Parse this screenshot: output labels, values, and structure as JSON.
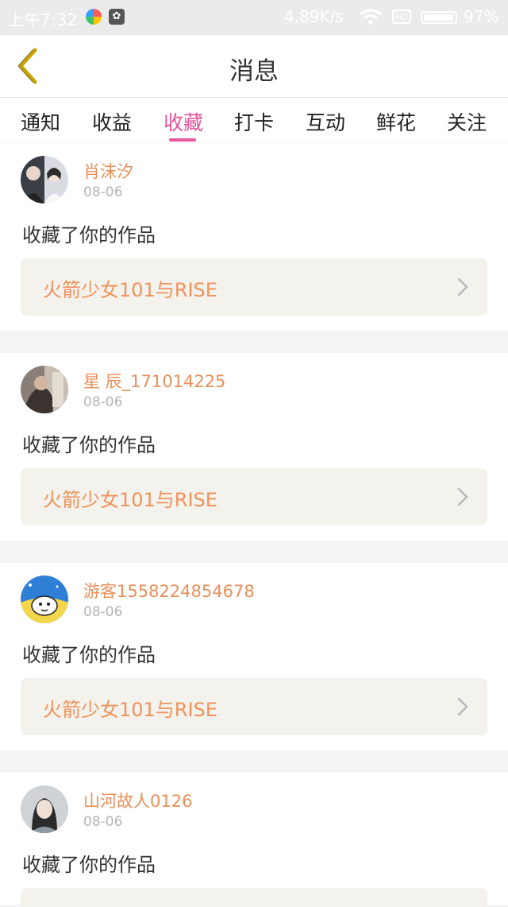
{
  "status_bar": {
    "time": "上午7:32",
    "network_speed": "4.89K/s",
    "battery_percent": "97%",
    "battery_level": 0.97,
    "icons": [
      "colorful-app-icon",
      "app-icon",
      "wifi-icon",
      "sim-icon",
      "battery-icon"
    ]
  },
  "header": {
    "title": "消息",
    "back_icon": "chevron-left-icon",
    "accent_color": "#c9a400"
  },
  "tabs": {
    "items": [
      {
        "label": "通知"
      },
      {
        "label": "收益"
      },
      {
        "label": "收藏"
      },
      {
        "label": "打卡"
      },
      {
        "label": "互动"
      },
      {
        "label": "鲜花"
      },
      {
        "label": "关注"
      }
    ],
    "active_index": 2,
    "active_color": "#e8559c"
  },
  "messages": [
    {
      "username": "肖沫汐",
      "date": "08-06",
      "action": "收藏了你的作品",
      "work_title": "火箭少女101与RISE"
    },
    {
      "username": "星 辰_171014225",
      "date": "08-06",
      "action": "收藏了你的作品",
      "work_title": "火箭少女101与RISE"
    },
    {
      "username": "游客1558224854678",
      "date": "08-06",
      "action": "收藏了你的作品",
      "work_title": "火箭少女101与RISE"
    },
    {
      "username": "山河故人0126",
      "date": "08-06",
      "action": "收藏了你的作品",
      "work_title": ""
    }
  ],
  "colors": {
    "username": "#e98f5a",
    "work_title": "#f0935b",
    "work_bg": "#f3f2ed"
  }
}
